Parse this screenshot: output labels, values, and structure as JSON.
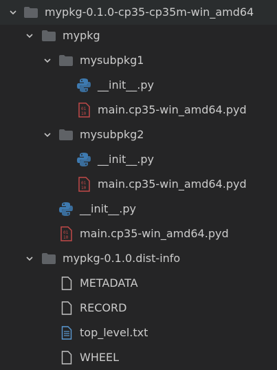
{
  "explorer": {
    "items": [
      {
        "label": "mypkg-0.1.0-cp35-cp35m-win_amd64",
        "kind": "folder",
        "expanded": true,
        "icon": "folder-icon"
      },
      {
        "label": "mypkg",
        "kind": "folder",
        "expanded": true,
        "icon": "folder-icon"
      },
      {
        "label": "mysubpkg1",
        "kind": "folder",
        "expanded": true,
        "icon": "folder-icon"
      },
      {
        "label": "__init__.py",
        "kind": "file",
        "icon": "python-icon"
      },
      {
        "label": "main.cp35-win_amd64.pyd",
        "kind": "file",
        "icon": "binary-file-icon"
      },
      {
        "label": "mysubpkg2",
        "kind": "folder",
        "expanded": true,
        "icon": "folder-icon"
      },
      {
        "label": "__init__.py",
        "kind": "file",
        "icon": "python-icon"
      },
      {
        "label": "main.cp35-win_amd64.pyd",
        "kind": "file",
        "icon": "binary-file-icon"
      },
      {
        "label": "__init__.py",
        "kind": "file",
        "icon": "python-icon"
      },
      {
        "label": "main.cp35-win_amd64.pyd",
        "kind": "file",
        "icon": "binary-file-icon"
      },
      {
        "label": "mypkg-0.1.0.dist-info",
        "kind": "folder",
        "expanded": true,
        "icon": "folder-icon"
      },
      {
        "label": "METADATA",
        "kind": "file",
        "icon": "file-icon"
      },
      {
        "label": "RECORD",
        "kind": "file",
        "icon": "file-icon"
      },
      {
        "label": "top_level.txt",
        "kind": "file",
        "icon": "text-file-icon"
      },
      {
        "label": "WHEEL",
        "kind": "file",
        "icon": "file-icon"
      }
    ]
  },
  "colors": {
    "background": "#252526",
    "text": "#cccccc",
    "folder": "#5f6266",
    "python_blue": "#3e7ab0",
    "python_yellow": "#c9b63c",
    "binary_red": "#c24a48",
    "text_file_blue": "#5b9bd5",
    "file_outline": "#c5c5c5"
  }
}
